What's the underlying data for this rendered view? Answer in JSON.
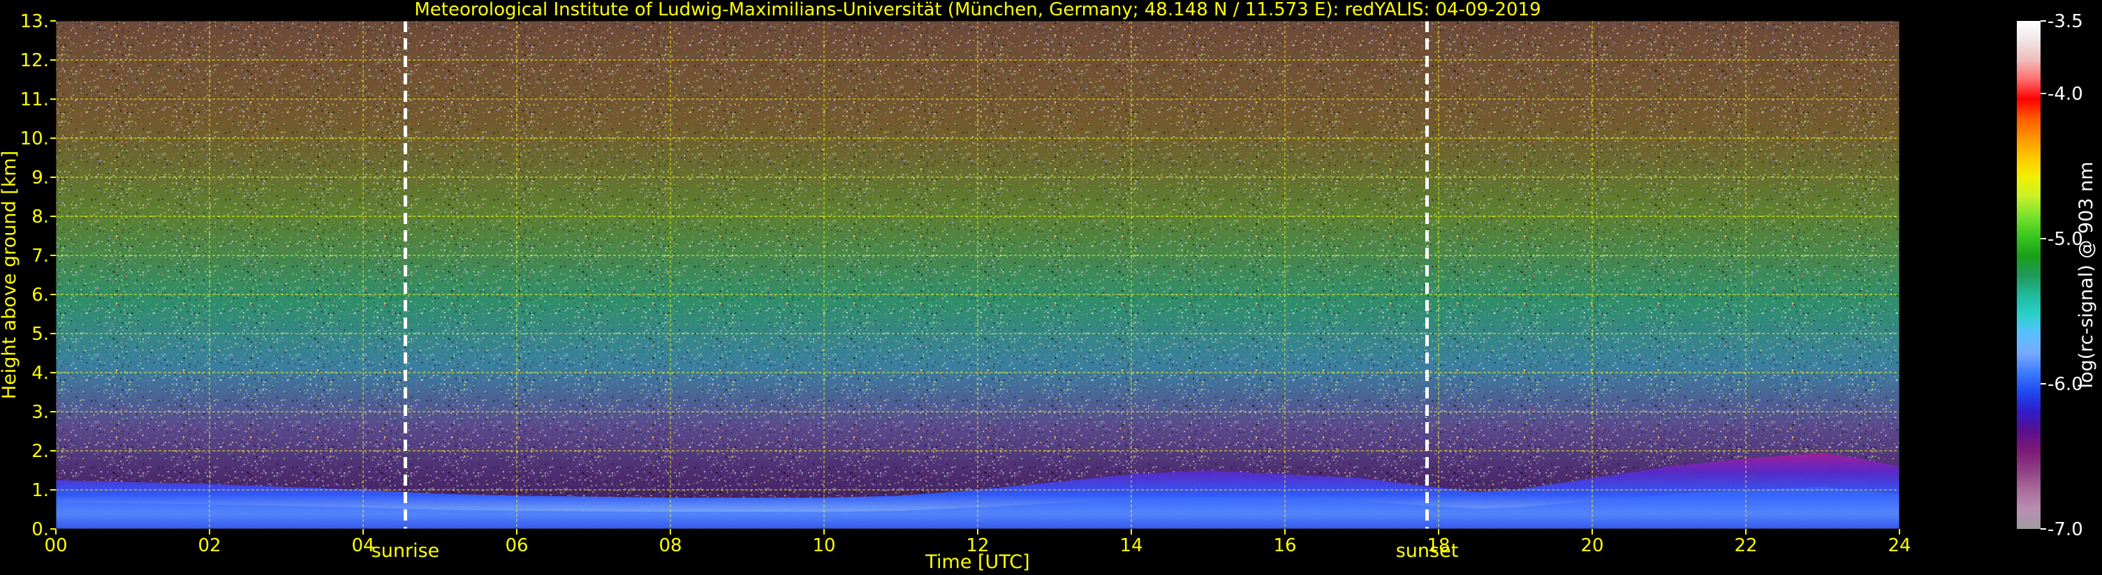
{
  "chart_data": {
    "type": "heatmap",
    "title": "Meteorological Institute of Ludwig-Maximilians-Universität (München, Germany; 48.148 N / 11.573 E):    redYALIS: 04-09-2019",
    "xlabel": "Time [UTC]",
    "ylabel": "Height above ground [km]",
    "xlim": [
      0,
      24
    ],
    "ylim": [
      0,
      13
    ],
    "x_ticks": [
      0,
      2,
      4,
      6,
      8,
      10,
      12,
      14,
      16,
      18,
      20,
      22,
      24
    ],
    "x_tick_labels": [
      "00",
      "02",
      "04",
      "06",
      "08",
      "10",
      "12",
      "14",
      "16",
      "18",
      "20",
      "22",
      "24"
    ],
    "y_ticks": [
      0,
      1,
      2,
      3,
      4,
      5,
      6,
      7,
      8,
      9,
      10,
      11,
      12,
      13
    ],
    "y_tick_labels": [
      "0.",
      "1.",
      "2.",
      "3.",
      "4.",
      "5.",
      "6.",
      "7.",
      "8.",
      "9.",
      "10.",
      "11.",
      "12.",
      "13."
    ],
    "grid": true,
    "annotations": [
      {
        "x": 4.55,
        "label": "sunrise",
        "style": "dashed-vertical-line"
      },
      {
        "x": 17.85,
        "label": "sunset",
        "style": "dashed-vertical-line"
      }
    ],
    "boundary_layer_top_km": {
      "time": [
        0,
        2,
        4,
        5,
        6,
        8,
        10,
        11,
        12,
        13,
        14,
        15,
        16,
        17,
        17.8,
        18.5,
        19,
        20,
        21,
        22,
        23,
        23.5,
        24
      ],
      "height": [
        1.25,
        1.15,
        1.0,
        0.9,
        0.85,
        0.8,
        0.8,
        0.85,
        1.0,
        1.2,
        1.4,
        1.5,
        1.4,
        1.3,
        1.1,
        0.95,
        1.0,
        1.3,
        1.6,
        1.8,
        1.95,
        1.8,
        1.6
      ]
    },
    "colorbar": {
      "label": "log(rc-signal) @ 903 nm",
      "range": [
        -7.0,
        -3.5
      ],
      "tick_labels": [
        "-3.5",
        "-4.0",
        "-5.0",
        "-6.0",
        "-7.0"
      ],
      "tick_values": [
        -3.5,
        -4.0,
        -5.0,
        -6.0,
        -7.0
      ],
      "colors": [
        "#a09aa0",
        "#b88fb0",
        "#a86c9c",
        "#8f3f84",
        "#7d1a78",
        "#5a0f8f",
        "#2e1cc8",
        "#1f48f0",
        "#3c7cff",
        "#78aaff",
        "#58c0ff",
        "#28d0c8",
        "#20b89a",
        "#1f9a58",
        "#1aa01a",
        "#38c81e",
        "#78e02c",
        "#c8f028",
        "#f0f000",
        "#ffc800",
        "#ff9600",
        "#ff5a00",
        "#ff0000",
        "#ff6e6e",
        "#f0bcbc",
        "#f0e6e6",
        "#ffffff"
      ]
    }
  }
}
